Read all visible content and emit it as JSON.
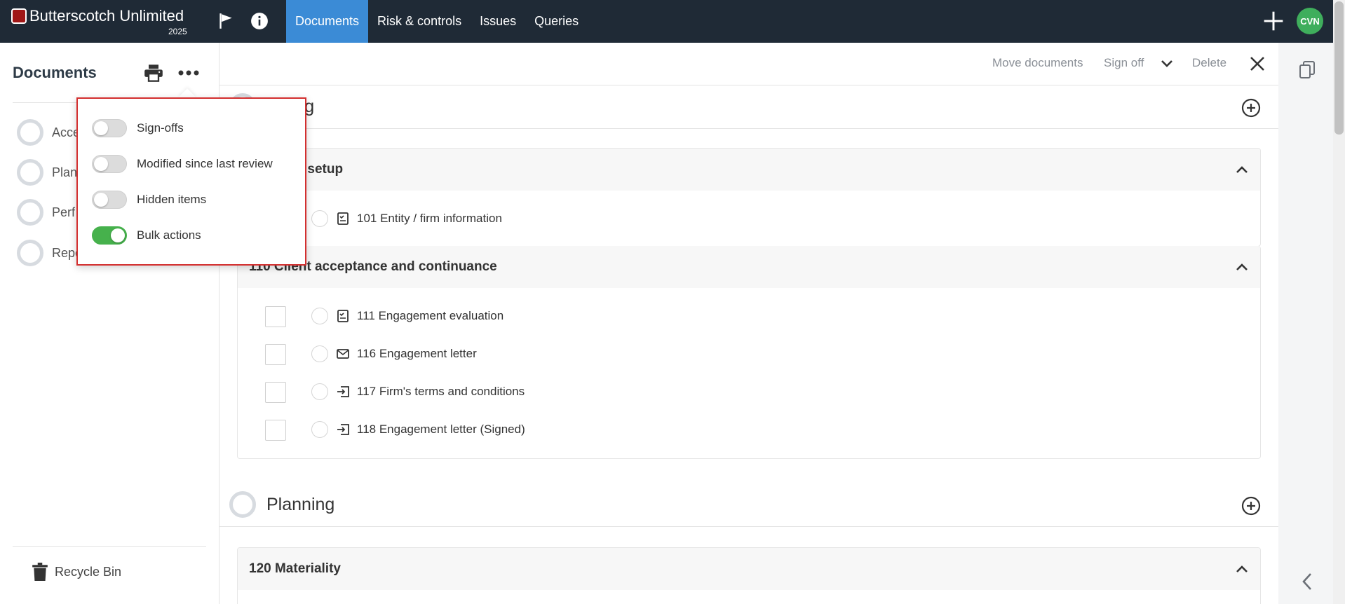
{
  "app": {
    "name": "Butterscotch Unlimited",
    "year": "2025",
    "user_initials": "CVN",
    "accent_color": "#3b8bd6",
    "topbar_color": "#1f2a36"
  },
  "nav": {
    "tabs": [
      {
        "label": "Documents",
        "active": true
      },
      {
        "label": "Risk & controls",
        "active": false
      },
      {
        "label": "Issues",
        "active": false
      },
      {
        "label": "Queries",
        "active": false
      }
    ]
  },
  "sidebar": {
    "title": "Documents",
    "items": [
      {
        "label": "Acce"
      },
      {
        "label": "Plan"
      },
      {
        "label": "Perf"
      },
      {
        "label": "Repo"
      }
    ],
    "recycle_label": "Recycle Bin"
  },
  "popover": {
    "options": [
      {
        "label": "Sign-offs",
        "enabled": false
      },
      {
        "label": "Modified since last review",
        "enabled": false
      },
      {
        "label": "Hidden items",
        "enabled": false
      },
      {
        "label": "Bulk actions",
        "enabled": true
      }
    ]
  },
  "actions": {
    "move": "Move documents",
    "signoff": "Sign off",
    "delete": "Delete"
  },
  "phases": [
    {
      "title": "epting"
    },
    {
      "title": "Planning"
    }
  ],
  "groups": [
    {
      "title": "agement setup",
      "rows": [
        {
          "label": "101 Entity / firm information",
          "icon": "checklist-icon"
        }
      ]
    },
    {
      "title": "110 Client acceptance and continuance",
      "rows": [
        {
          "label": "111 Engagement evaluation",
          "icon": "checklist-icon"
        },
        {
          "label": "116 Engagement letter",
          "icon": "envelope-icon"
        },
        {
          "label": "117 Firm's terms and conditions",
          "icon": "import-icon"
        },
        {
          "label": "118 Engagement letter (Signed)",
          "icon": "import-icon"
        }
      ]
    },
    {
      "title": "120 Materiality",
      "rows": []
    }
  ]
}
